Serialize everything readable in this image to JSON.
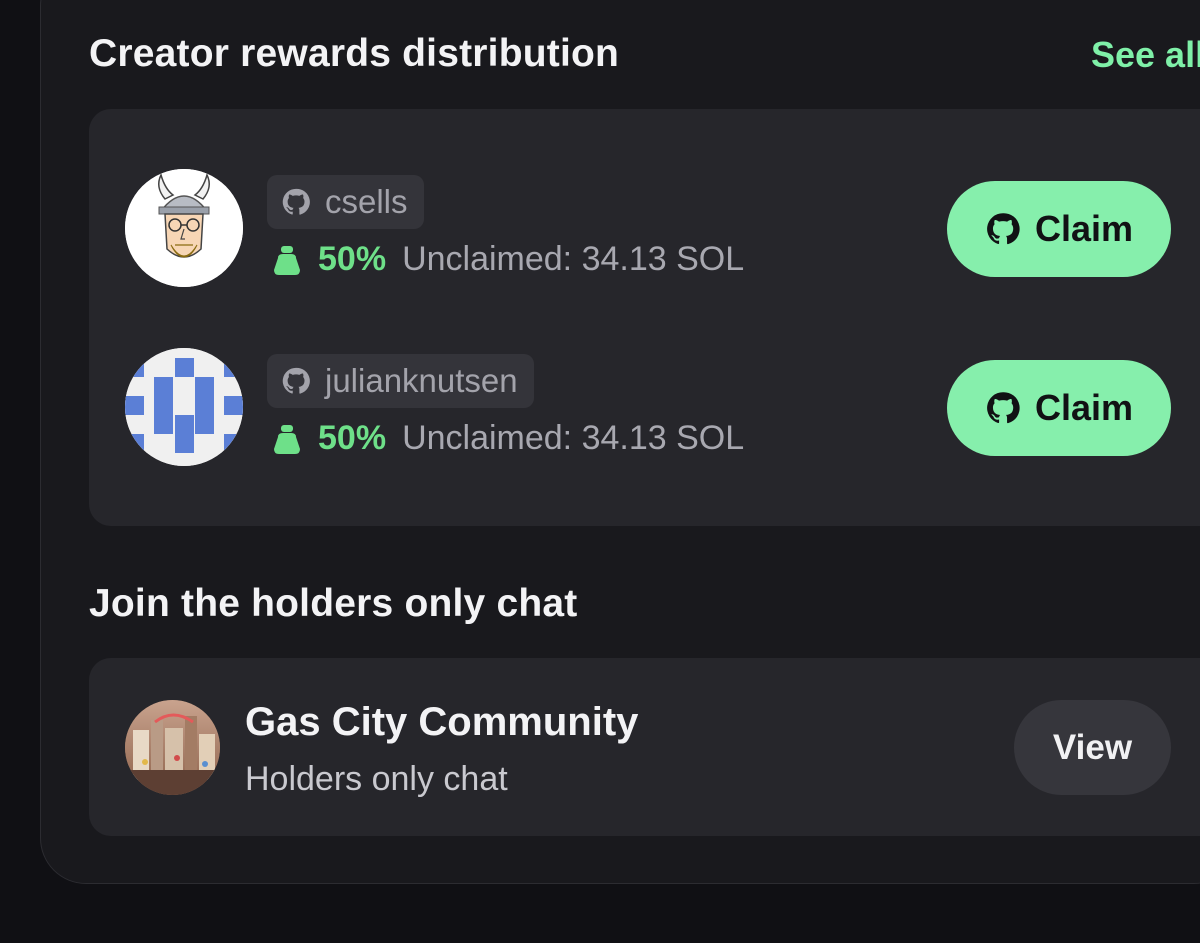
{
  "rewards": {
    "title": "Creator rewards distribution",
    "see_all": "See all",
    "creators": [
      {
        "handle": "csells",
        "share": "50%",
        "unclaimed": "Unclaimed: 34.13 SOL",
        "claim_label": "Claim",
        "avatar_icon": "viking-cartoon-avatar"
      },
      {
        "handle": "julianknutsen",
        "share": "50%",
        "unclaimed": "Unclaimed: 34.13 SOL",
        "claim_label": "Claim",
        "avatar_icon": "blue-pixel-identicon-avatar"
      }
    ]
  },
  "chat": {
    "title": "Join the holders only chat",
    "name": "Gas City Community",
    "subtitle": "Holders only chat",
    "view_label": "View",
    "avatar_icon": "community-photo-avatar"
  },
  "colors": {
    "accent_green": "#86efac",
    "percent_green": "#6ee089",
    "background": "#101014",
    "panel": "#19191d",
    "card": "#26262b"
  }
}
